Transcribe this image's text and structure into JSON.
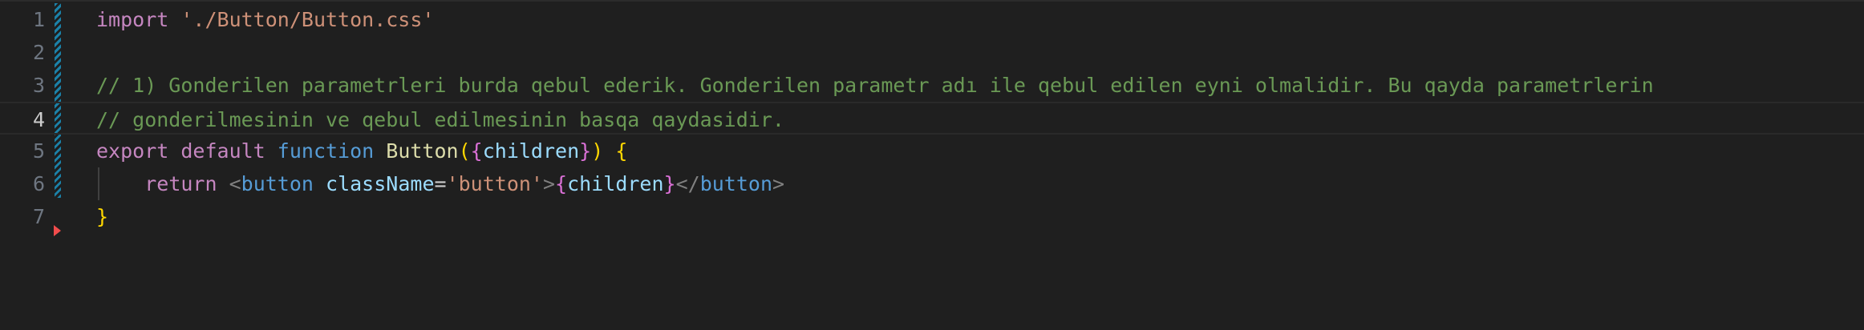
{
  "editor": {
    "current_line": 4,
    "lines": [
      {
        "number": "1",
        "tokens": [
          {
            "type": "kw",
            "text": "import"
          },
          {
            "type": "plain",
            "text": " "
          },
          {
            "type": "str",
            "text": "'./Button/Button.css'"
          }
        ]
      },
      {
        "number": "2",
        "tokens": []
      },
      {
        "number": "3",
        "tokens": [
          {
            "type": "cmt",
            "text": "// 1) Gonderilen parametrleri burda qebul ederik. Gonderilen parametr adı ile qebul edilen eyni olmalidir. Bu qayda parametrlerin"
          }
        ]
      },
      {
        "number": "4",
        "tokens": [
          {
            "type": "cmt",
            "text": "// gonderilmesinin ve qebul edilmesinin basqa qaydasidir."
          }
        ]
      },
      {
        "number": "5",
        "tokens": [
          {
            "type": "kw",
            "text": "export"
          },
          {
            "type": "plain",
            "text": " "
          },
          {
            "type": "kw",
            "text": "default"
          },
          {
            "type": "plain",
            "text": " "
          },
          {
            "type": "kw-blue",
            "text": "function"
          },
          {
            "type": "plain",
            "text": " "
          },
          {
            "type": "fn",
            "text": "Button"
          },
          {
            "type": "brace1",
            "text": "("
          },
          {
            "type": "brace2",
            "text": "{"
          },
          {
            "type": "var",
            "text": "children"
          },
          {
            "type": "brace2",
            "text": "}"
          },
          {
            "type": "brace1",
            "text": ")"
          },
          {
            "type": "plain",
            "text": " "
          },
          {
            "type": "brace1",
            "text": "{"
          }
        ]
      },
      {
        "number": "6",
        "tokens": [
          {
            "type": "plain",
            "text": "    "
          },
          {
            "type": "kw",
            "text": "return"
          },
          {
            "type": "plain",
            "text": " "
          },
          {
            "type": "tag-punct",
            "text": "<"
          },
          {
            "type": "tag",
            "text": "button"
          },
          {
            "type": "plain",
            "text": " "
          },
          {
            "type": "attr",
            "text": "className"
          },
          {
            "type": "plain",
            "text": "="
          },
          {
            "type": "str",
            "text": "'button'"
          },
          {
            "type": "tag-punct",
            "text": ">"
          },
          {
            "type": "brace2",
            "text": "{"
          },
          {
            "type": "var",
            "text": "children"
          },
          {
            "type": "brace2",
            "text": "}"
          },
          {
            "type": "tag-punct",
            "text": "</"
          },
          {
            "type": "tag",
            "text": "button"
          },
          {
            "type": "tag-punct",
            "text": ">"
          }
        ]
      },
      {
        "number": "7",
        "tokens": [
          {
            "type": "brace1",
            "text": "}"
          }
        ]
      }
    ]
  }
}
